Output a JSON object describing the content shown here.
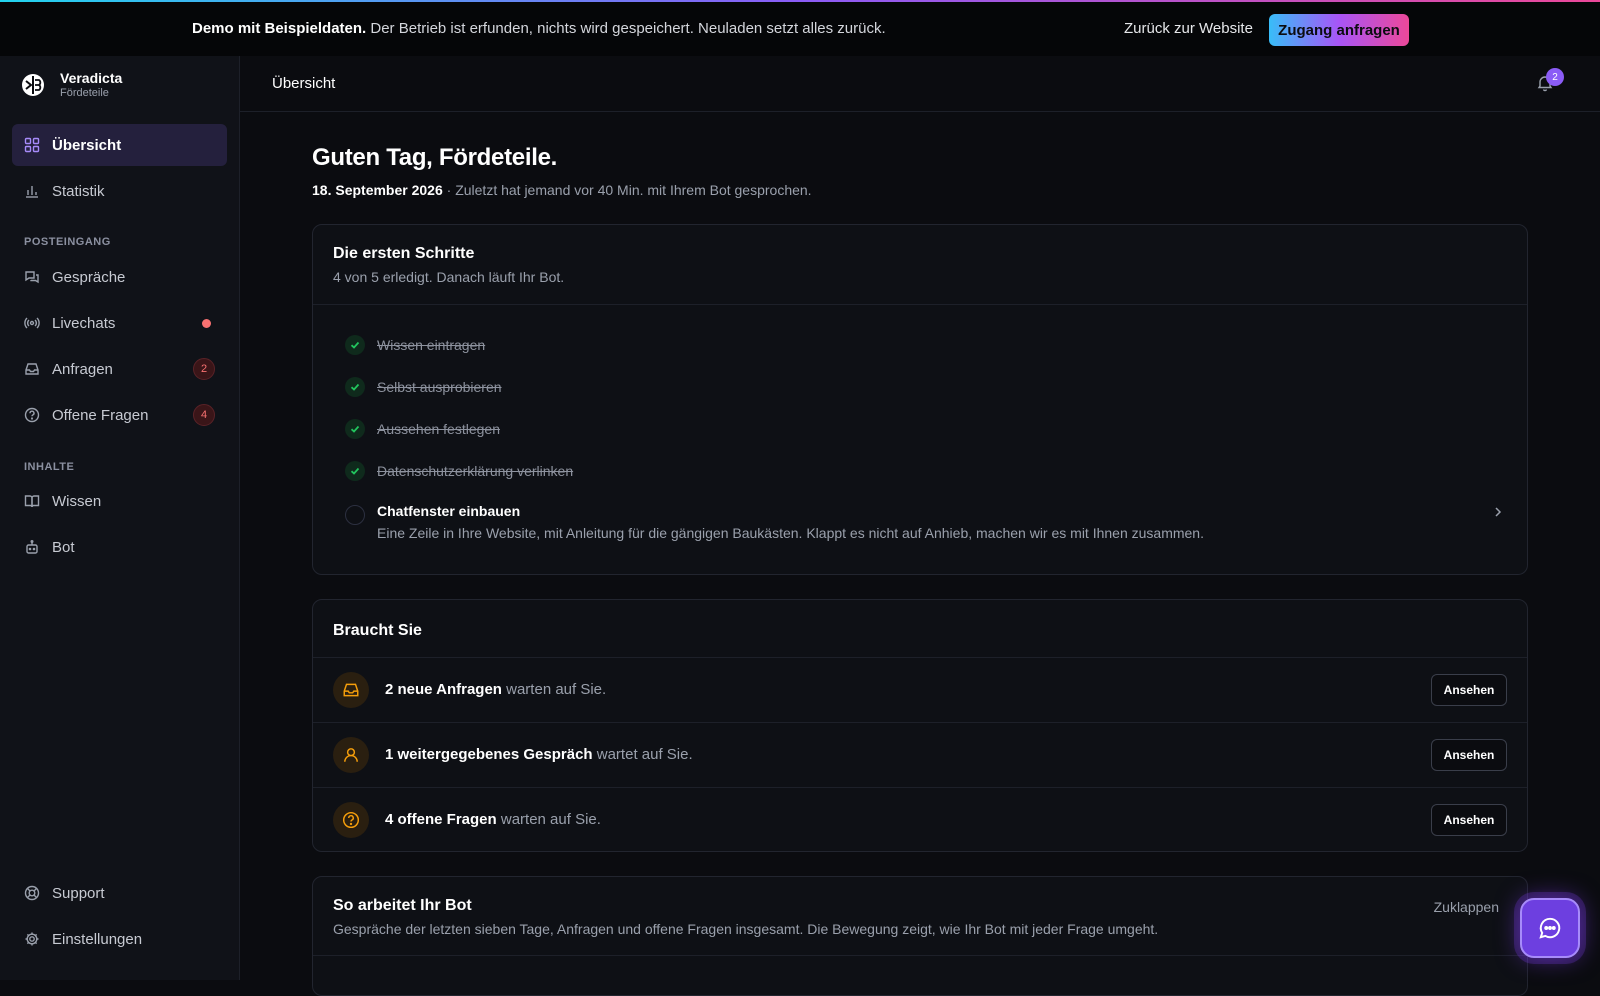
{
  "banner": {
    "bold": "Demo mit Beispieldaten.",
    "text": " Der Betrieb ist erfunden, nichts wird gespeichert. Neuladen setzt alles zurück.",
    "back_link": "Zurück zur Website",
    "cta": "Zugang anfragen"
  },
  "brand": {
    "name": "Veradicta",
    "sub": "Fördeteile"
  },
  "sidebar": {
    "items": [
      {
        "label": "Übersicht"
      },
      {
        "label": "Statistik"
      }
    ],
    "section_inbox": "POSTEINGANG",
    "inbox": [
      {
        "label": "Gespräche"
      },
      {
        "label": "Livechats"
      },
      {
        "label": "Anfragen",
        "badge": "2"
      },
      {
        "label": "Offene Fragen",
        "badge": "4"
      }
    ],
    "section_content": "INHALTE",
    "content": [
      {
        "label": "Wissen"
      },
      {
        "label": "Bot"
      }
    ],
    "footer": [
      {
        "label": "Support"
      },
      {
        "label": "Einstellungen"
      }
    ]
  },
  "topbar": {
    "title": "Übersicht",
    "notifications": "2"
  },
  "main": {
    "greeting": "Guten Tag, Fördeteile.",
    "date": "18. September 2026",
    "last_seen": " · Zuletzt hat jemand vor 40 Min. mit Ihrem Bot gesprochen.",
    "steps_card": {
      "title": "Die ersten Schritte",
      "sub": "4 von 5 erledigt. Danach läuft Ihr Bot.",
      "done": [
        "Wissen eintragen",
        "Selbst ausprobieren",
        "Aussehen festlegen",
        "Datenschutzerklärung verlinken"
      ],
      "open_title": "Chatfenster einbauen",
      "open_desc": "Eine Zeile in Ihre Website, mit Anleitung für die gängigen Baukästen. Klappt es nicht auf Anhieb, machen wir es mit Ihnen zusammen."
    },
    "needs_card": {
      "title": "Braucht Sie",
      "rows": [
        {
          "bold": "2 neue Anfragen",
          "rest": " warten auf Sie.",
          "button": "Ansehen"
        },
        {
          "bold": "1 weitergegebenes Gespräch",
          "rest": " wartet auf Sie.",
          "button": "Ansehen"
        },
        {
          "bold": "4 offene Fragen",
          "rest": " warten auf Sie.",
          "button": "Ansehen"
        }
      ]
    },
    "bot_card": {
      "title": "So arbeitet Ihr Bot",
      "sub": "Gespräche der letzten sieben Tage, Anfragen und offene Fragen insgesamt. Die Bewegung zeigt, wie Ihr Bot mit jeder Frage umgeht.",
      "collapse": "Zuklappen"
    }
  },
  "colors": {
    "accent": "#8b5cf6",
    "success": "#22c55e",
    "warning": "#f59e0b",
    "danger": "#f87171"
  }
}
